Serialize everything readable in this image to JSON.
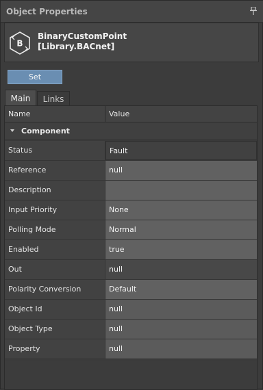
{
  "window": {
    "title": "Object Properties",
    "pin_icon": "pin-icon"
  },
  "object": {
    "icon": "bacnet-object-icon",
    "icon_letter": "B",
    "name_line1": "BinaryCustomPoint",
    "name_line2": "[Library.BACnet]"
  },
  "toolbar": {
    "set_label": "Set"
  },
  "tabs": [
    {
      "label": "Main",
      "active": true
    },
    {
      "label": "Links",
      "active": false
    }
  ],
  "grid": {
    "columns": {
      "name": "Name",
      "value": "Value"
    },
    "group": "Component",
    "rows": [
      {
        "name": "Status",
        "value": "Fault"
      },
      {
        "name": "Reference",
        "value": "null"
      },
      {
        "name": "Description",
        "value": ""
      },
      {
        "name": "Input Priority",
        "value": "None"
      },
      {
        "name": "Polling Mode",
        "value": "Normal"
      },
      {
        "name": "Enabled",
        "value": "true"
      },
      {
        "name": "Out",
        "value": "null"
      },
      {
        "name": "Polarity Conversion",
        "value": "Default"
      },
      {
        "name": "Object Id",
        "value": "null"
      },
      {
        "name": "Object Type",
        "value": "null"
      },
      {
        "name": "Property",
        "value": "null"
      }
    ]
  },
  "colors": {
    "accent": "#6a8eb2",
    "panel": "#3c3c3c"
  }
}
